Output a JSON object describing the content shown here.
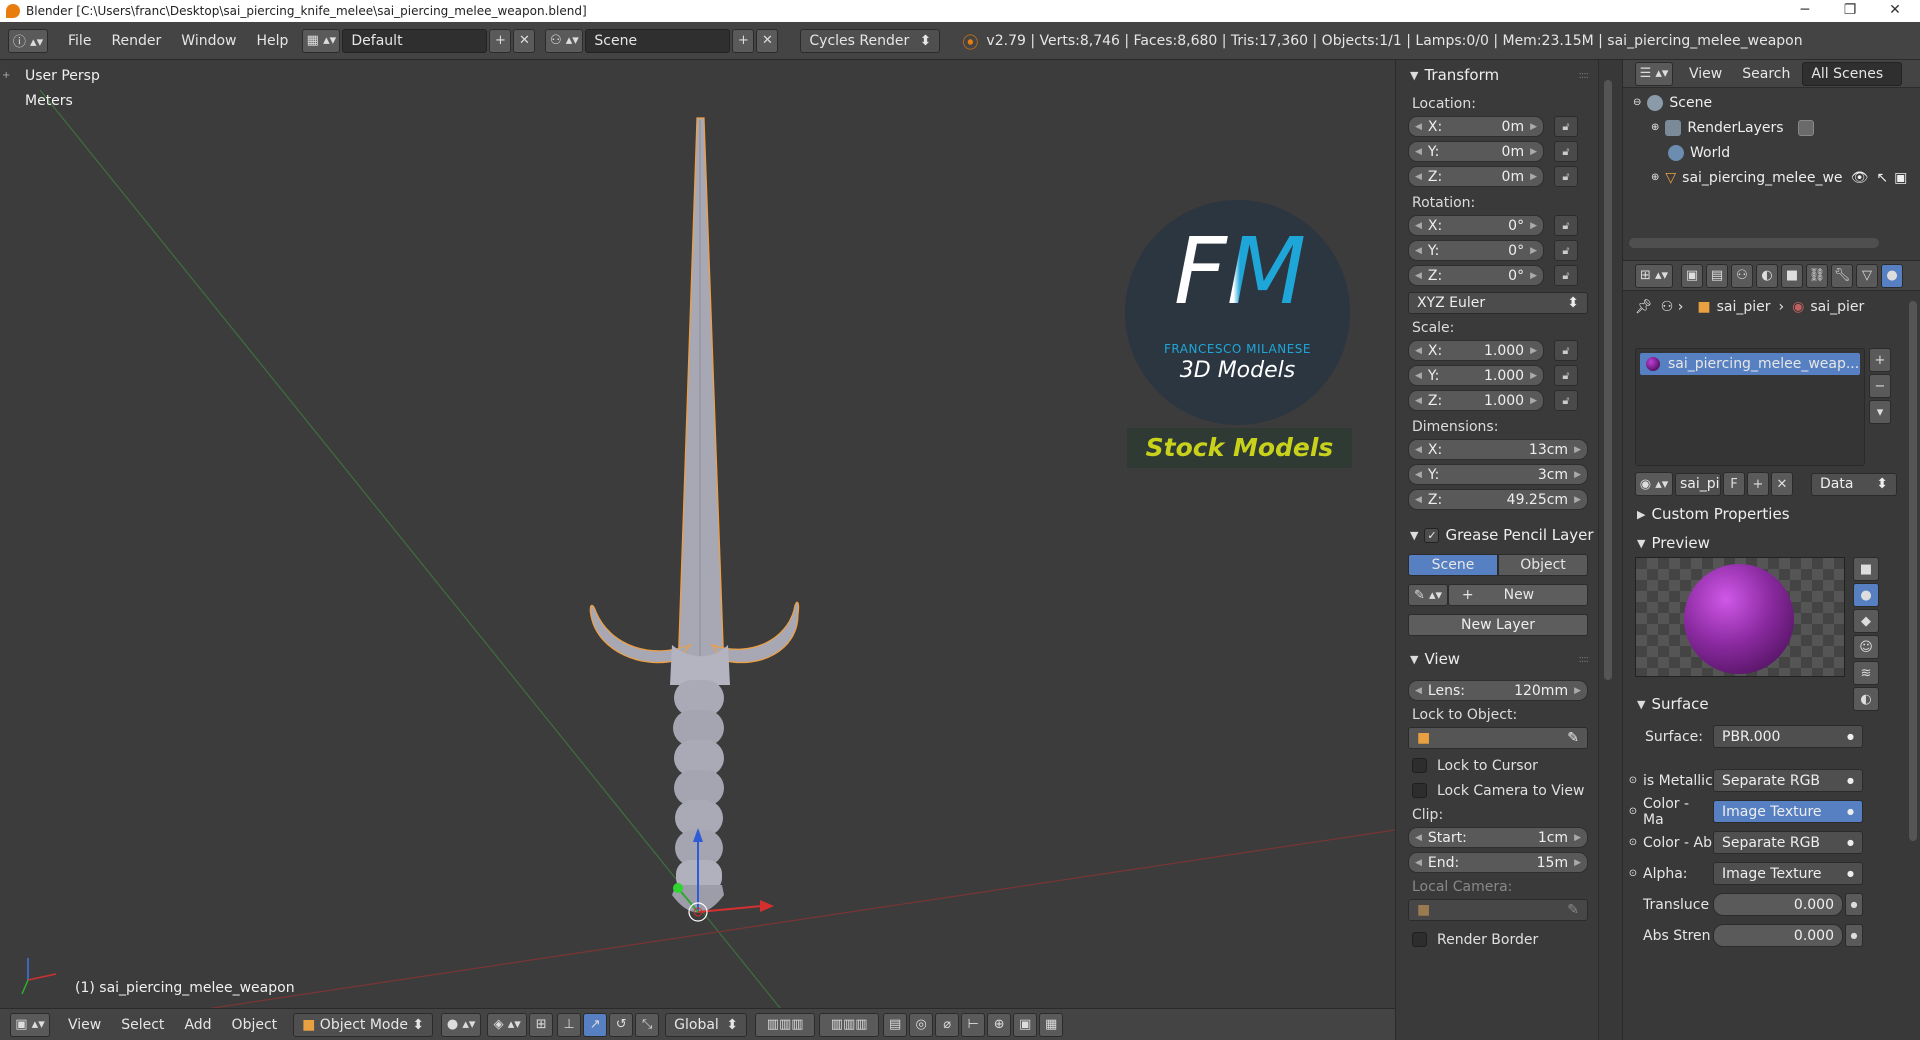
{
  "titlebar": {
    "title": "Blender [C:\\Users\\franc\\Desktop\\sai_piercing_knife_melee\\sai_piercing_melee_weapon.blend]",
    "minimize": "─",
    "maximize": "❐",
    "close": "✕"
  },
  "header": {
    "menu": [
      "File",
      "Render",
      "Window",
      "Help"
    ],
    "screen_layout": "Default",
    "scene": "Scene",
    "render_engine": "Cycles Render",
    "stats": "v2.79 | Verts:8,746 | Faces:8,680 | Tris:17,360 | Objects:1/1 | Lamps:0/0 | Mem:23.15M | sai_piercing_melee_weapon"
  },
  "viewport": {
    "view_name": "User Persp",
    "units": "Meters",
    "object_label": "(1) sai_piercing_melee_weapon",
    "logo": {
      "letters": "FM",
      "name": "FRANCESCO MILANESE",
      "subtitle": "3D Models",
      "banner": "Stock Models"
    }
  },
  "footer": {
    "menu": [
      "View",
      "Select",
      "Add",
      "Object"
    ],
    "mode": "Object Mode",
    "orientation": "Global"
  },
  "npanel": {
    "transform_title": "Transform",
    "location_label": "Location:",
    "location": [
      {
        "axis": "X:",
        "value": "0m"
      },
      {
        "axis": "Y:",
        "value": "0m"
      },
      {
        "axis": "Z:",
        "value": "0m"
      }
    ],
    "rotation_label": "Rotation:",
    "rotation": [
      {
        "axis": "X:",
        "value": "0°"
      },
      {
        "axis": "Y:",
        "value": "0°"
      },
      {
        "axis": "Z:",
        "value": "0°"
      }
    ],
    "rotation_mode": "XYZ Euler",
    "scale_label": "Scale:",
    "scale": [
      {
        "axis": "X:",
        "value": "1.000"
      },
      {
        "axis": "Y:",
        "value": "1.000"
      },
      {
        "axis": "Z:",
        "value": "1.000"
      }
    ],
    "dimensions_label": "Dimensions:",
    "dimensions": [
      {
        "axis": "X:",
        "value": "13cm"
      },
      {
        "axis": "Y:",
        "value": "3cm"
      },
      {
        "axis": "Z:",
        "value": "49.25cm"
      }
    ],
    "grease_title": "Grease Pencil Layer",
    "grease_tabs": [
      "Scene",
      "Object"
    ],
    "new_label": "New",
    "new_layer_label": "New Layer",
    "view_title": "View",
    "lens_label": "Lens:",
    "lens_value": "120mm",
    "lock_to_object_label": "Lock to Object:",
    "lock_to_cursor": "Lock to Cursor",
    "lock_camera": "Lock Camera to View",
    "clip_label": "Clip:",
    "clip_start_label": "Start:",
    "clip_start": "1cm",
    "clip_end_label": "End:",
    "clip_end": "15m",
    "local_camera_label": "Local Camera:",
    "render_border": "Render Border"
  },
  "outliner": {
    "header": [
      "View",
      "Search",
      "All Scenes"
    ],
    "items": [
      "Scene",
      "RenderLayers",
      "World",
      "sai_piercing_melee_we"
    ]
  },
  "properties": {
    "breadcrumb": [
      "sai_pier",
      "sai_pier"
    ],
    "material_slot": "sai_piercing_melee_weap...",
    "material_name": "sai_pi",
    "fake_user": "F",
    "link_mode": "Data",
    "custom_properties": "Custom Properties",
    "preview": "Preview",
    "surface_title": "Surface",
    "surface_label": "Surface:",
    "surface_value": "PBR.000",
    "inputs": [
      {
        "label": "is Metallic",
        "value": "Separate RGB"
      },
      {
        "label": "Color - Ma",
        "value": "Image Texture"
      },
      {
        "label": "Color - Ab",
        "value": "Separate RGB"
      },
      {
        "label": "Alpha:",
        "value": "Image Texture"
      }
    ],
    "translucency_label": "Transluce",
    "translucency_value": "0.000",
    "abs_strength_label": "Abs Stren",
    "abs_strength_value": "0.000"
  },
  "colors": {
    "accent_blue": "#5680c2",
    "selection_orange": "#f0a040",
    "logo_cyan": "#1fa6d8",
    "logo_banner": "#c9d21a",
    "material_purple": "#8a2aa0"
  }
}
